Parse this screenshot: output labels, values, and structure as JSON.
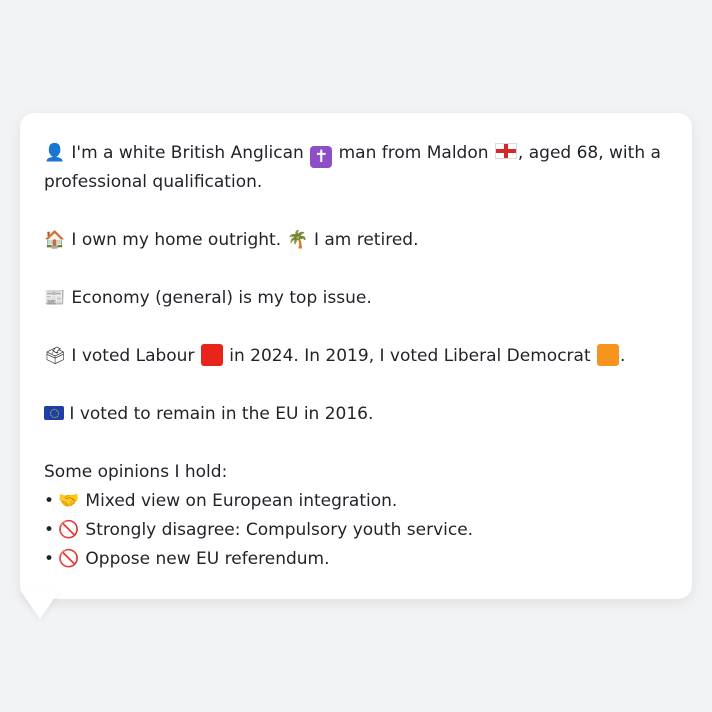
{
  "profile": {
    "line1": {
      "icon": "bust-in-silhouette-icon",
      "pre": "I'm a white British Anglican",
      "religion_icon": "latin-cross-icon",
      "mid": "man from Maldon",
      "flag_icon": "england-flag-icon",
      "post": ", aged 68, with a",
      "cont": "professional qualification."
    },
    "line2": {
      "home_icon": "house-icon",
      "home_text": "I own my home outright.",
      "work_icon": "palm-tree-icon",
      "work_text": "I am retired."
    },
    "line3": {
      "icon": "newspaper-icon",
      "text": "Economy (general) is my top issue."
    },
    "line4": {
      "icon": "ballot-box-icon",
      "pre": "I voted Labour",
      "labour_color": "#e8241b",
      "mid": "in 2024. In 2019, I voted Liberal Democrat",
      "libdem_color": "#f7941d",
      "post": "."
    },
    "line5": {
      "icon": "eu-flag-icon",
      "text": "I voted to remain in the EU in 2016."
    },
    "opinions": {
      "heading": "Some opinions I hold:",
      "items": [
        {
          "icon": "handshake-icon",
          "text": "Mixed view on European integration."
        },
        {
          "icon": "prohibited-icon",
          "text": "Strongly disagree: Compulsory youth service."
        },
        {
          "icon": "prohibited-icon",
          "text": "Oppose new EU referendum."
        }
      ]
    }
  },
  "colors": {
    "page_background": "#f2f3f5",
    "bubble_background": "#ffffff",
    "text": "#1f2328"
  }
}
